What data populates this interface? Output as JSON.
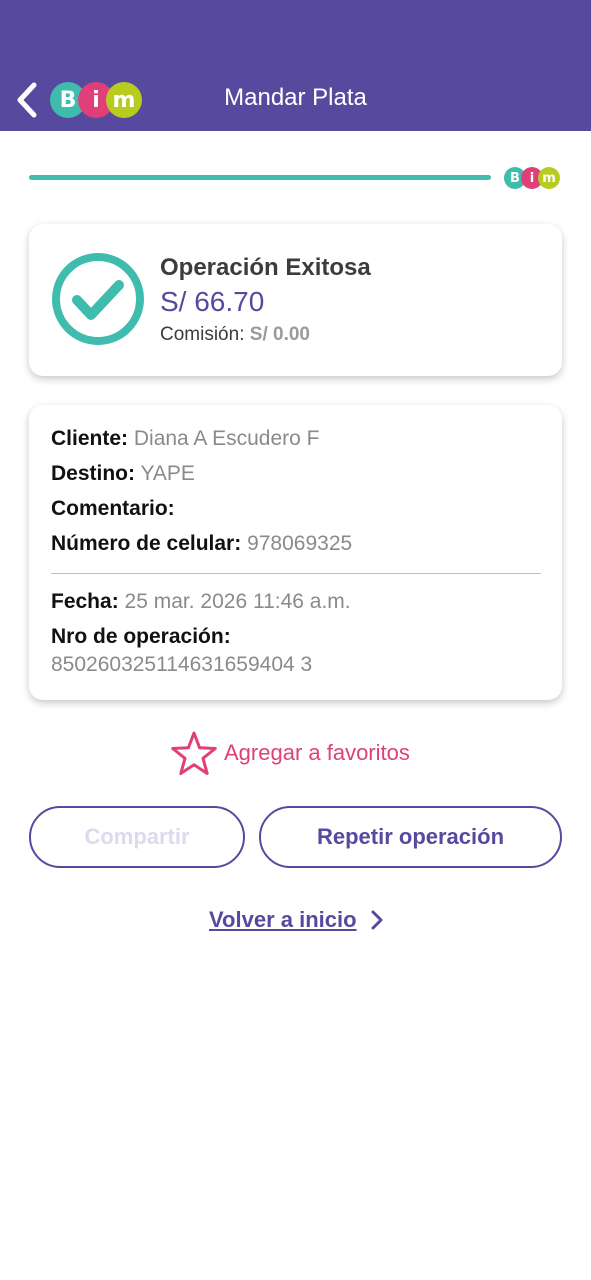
{
  "header": {
    "title": "Mandar Plata",
    "back_icon": "chevron-left-icon",
    "logo_letters": [
      "B",
      "i",
      "m"
    ],
    "logo_colors": [
      "#3fbcae",
      "#e0407a",
      "#b7cc1e"
    ]
  },
  "progress": {
    "fraction": 1.0,
    "color": "#3fbcae"
  },
  "result": {
    "title": "Operación Exitosa",
    "amount": "S/ 66.70",
    "commission_label": "Comisión:",
    "commission_value": "S/ 0.00",
    "status_icon": "check-circle-icon"
  },
  "details": {
    "cliente_label": "Cliente:",
    "cliente_value": "Diana A Escudero F",
    "destino_label": "Destino:",
    "destino_value": "YAPE",
    "comentario_label": "Comentario:",
    "comentario_value": "",
    "celular_label": "Número de celular:",
    "celular_value": "978069325",
    "fecha_label": "Fecha:",
    "fecha_value": "25 mar. 2026 11:46 a.m.",
    "operacion_label": "Nro de operación:",
    "operacion_value": "850260325114631659404 3"
  },
  "actions": {
    "favorite_label": "Agregar a favoritos",
    "favorite_icon": "star-outline-icon",
    "share_label": "Compartir",
    "repeat_label": "Repetir operación",
    "home_label": "Volver a inicio",
    "home_icon": "chevron-right-icon"
  },
  "colors": {
    "brand_purple": "#574a9e",
    "accent_teal": "#3fbcae",
    "accent_pink": "#e0407a"
  }
}
